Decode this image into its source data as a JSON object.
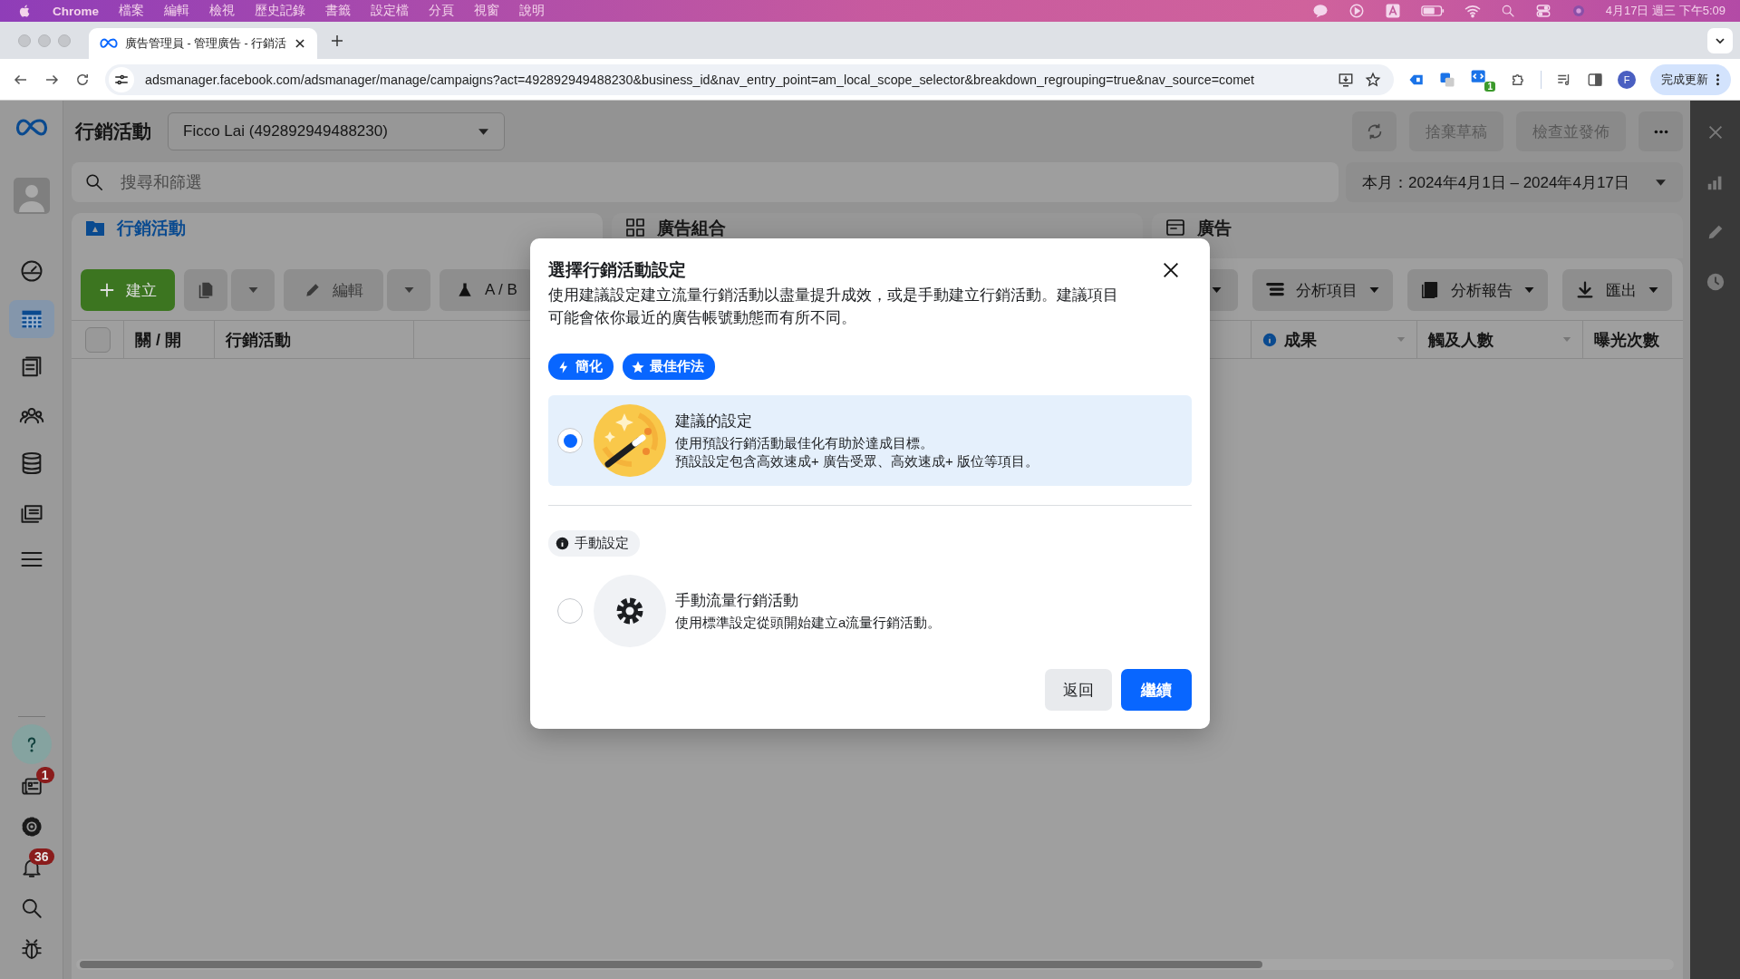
{
  "menu_bar": {
    "app": "Chrome",
    "items": [
      "檔案",
      "編輯",
      "檢視",
      "歷史記錄",
      "書籤",
      "設定檔",
      "分頁",
      "視窗",
      "說明"
    ],
    "clock": "4月17日 週三 下午5:09"
  },
  "browser": {
    "tabs": [
      {
        "title": "廣告管理員 - 管理廣告 - 行銷活",
        "selected": true
      }
    ],
    "url": "adsmanager.facebook.com/adsmanager/manage/campaigns?act=492892949488230&business_id&nav_entry_point=am_local_scope_selector&breakdown_regrouping=true&nav_source=comet",
    "extension_badge": "1",
    "profile_initial": "F",
    "update_button": "完成更新"
  },
  "nav": {
    "items": [
      {
        "kind": "gauge",
        "selected": false
      },
      {
        "kind": "table",
        "selected": true
      },
      {
        "kind": "book",
        "selected": false
      },
      {
        "kind": "people",
        "selected": false
      },
      {
        "kind": "stack",
        "selected": false
      },
      {
        "kind": "media",
        "selected": false
      },
      {
        "kind": "menu",
        "selected": false
      }
    ],
    "bottom": [
      {
        "kind": "help"
      },
      {
        "kind": "news",
        "badge": "1"
      },
      {
        "kind": "gear"
      },
      {
        "kind": "bell",
        "badge": "36"
      },
      {
        "kind": "search"
      },
      {
        "kind": "bug"
      }
    ]
  },
  "header": {
    "title": "行銷活動",
    "account": "Ficco Lai (492892949488230)",
    "buttons": [
      "捨棄草稿",
      "檢查並發佈"
    ]
  },
  "search": {
    "placeholder": "搜尋和篩選"
  },
  "date_range": "本月：2024年4月1日 – 2024年4月17日",
  "level_tabs": [
    {
      "label": "行銷活動",
      "selected": true,
      "kind": "folder"
    },
    {
      "label": "廣告組合",
      "selected": false,
      "kind": "grid"
    },
    {
      "label": "廣告",
      "selected": false,
      "kind": "ad"
    }
  ],
  "toolbar": {
    "create": "建立",
    "edit": "編輯",
    "ab_test": "A / B",
    "right": [
      {
        "label": "分析項目",
        "kind": "columns"
      },
      {
        "label": "分析報告",
        "kind": "reports"
      },
      {
        "label": "匯出",
        "kind": "download"
      }
    ]
  },
  "table": {
    "select_all_checked": false,
    "columns": [
      "關 / 開",
      "行銷活動",
      "成果",
      "觸及人數",
      "曝光次數"
    ]
  },
  "modal": {
    "title": "選擇行銷活動設定",
    "description": "使用建議設定建立流量行銷活動以盡量提升成效，或是手動建立行銷活動。建議項目可能會依你最近的廣告帳號動態而有所不同。",
    "tags": [
      {
        "label": "簡化",
        "kind": "bolt"
      },
      {
        "label": "最佳作法",
        "kind": "star"
      }
    ],
    "options": [
      {
        "kind": "wand",
        "title": "建議的設定",
        "lines": [
          "使用預設行銷活動最佳化有助於達成目標。",
          "預設設定包含高效速成+ 廣告受眾、高效速成+ 版位等項目。"
        ],
        "selected": true
      },
      {
        "kind": "gear",
        "title": "手動流量行銷活動",
        "lines": [
          "使用標準設定從頭開始建立a流量行銷活動。"
        ],
        "selected": false
      }
    ],
    "section_label": "手動設定",
    "back_button": "返回",
    "continue_button": "繼續"
  }
}
